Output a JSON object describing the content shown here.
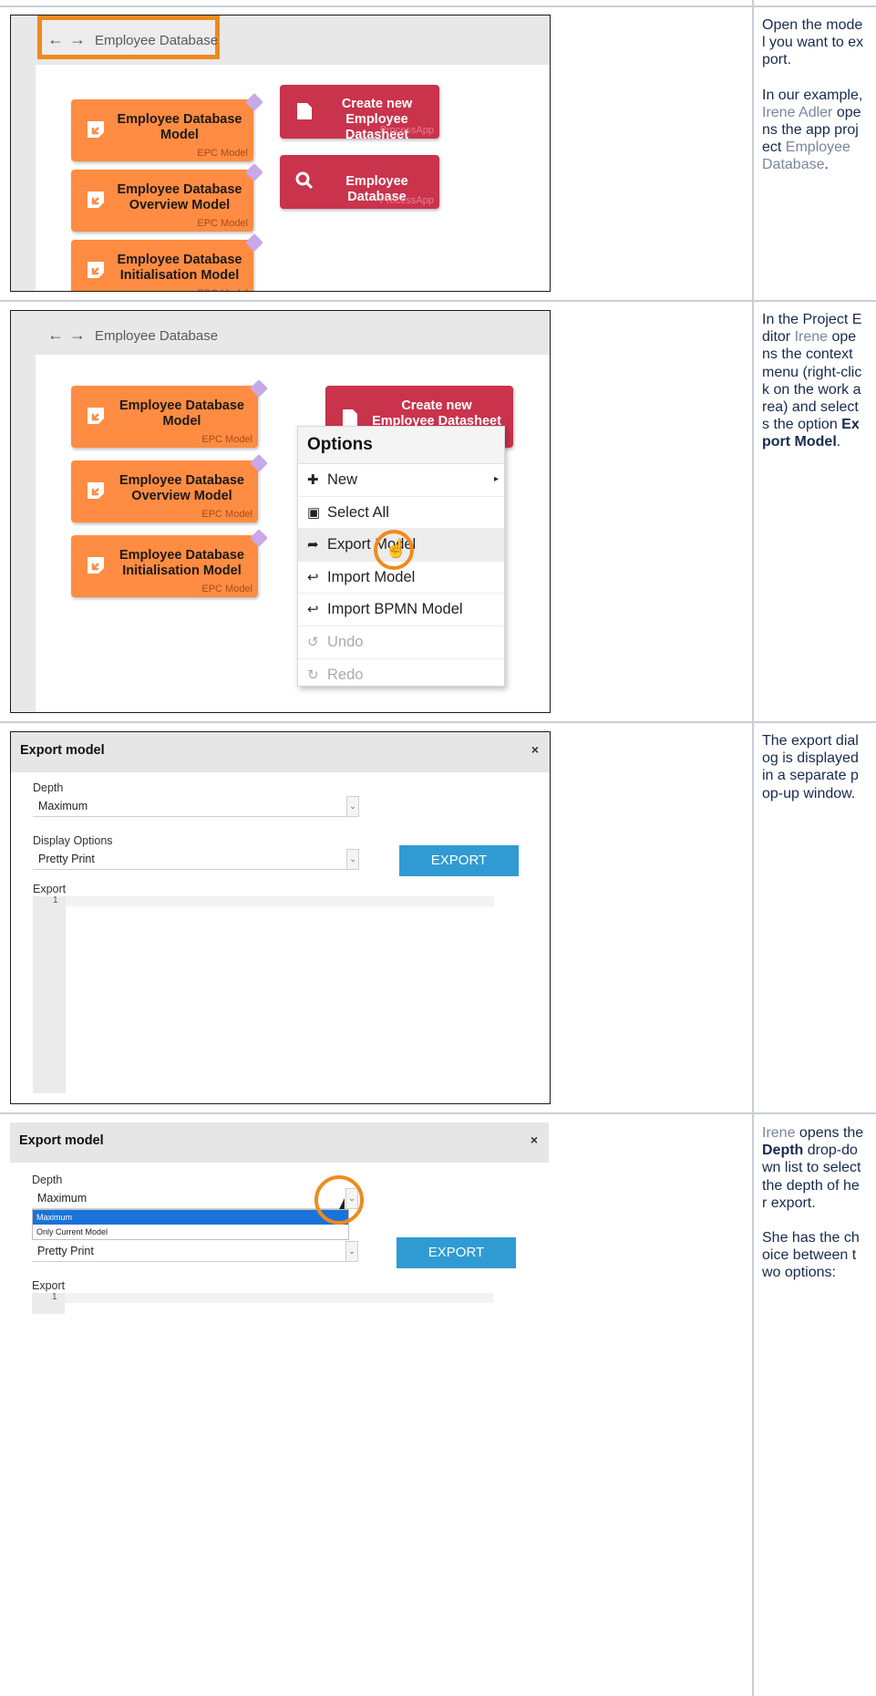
{
  "app": {
    "title": "Employee Database",
    "nav_back": "←",
    "nav_forward": "→"
  },
  "tiles": {
    "epc1": {
      "title": "Employee Database Model",
      "type": "EPC Model"
    },
    "epc2": {
      "title": "Employee Database Overview Model",
      "type": "EPC Model"
    },
    "epc3": {
      "title": "Employee Database Initialisation Model",
      "type": "EPC Model"
    },
    "app1": {
      "title": "Create new Employee Datasheet",
      "type": "ProcessApp"
    },
    "app2": {
      "title": "Employee Database",
      "type": "ProcessApp"
    }
  },
  "context_menu": {
    "header": "Options",
    "items": [
      {
        "label": "New",
        "icon": "plus-icon",
        "glyph": "✚",
        "submenu": "▸"
      },
      {
        "label": "Select All",
        "icon": "select-all-icon",
        "glyph": "▣"
      },
      {
        "label": "Export Model",
        "icon": "share-arrow-icon",
        "glyph": "➦"
      },
      {
        "label": "Import Model",
        "icon": "reply-arrow-icon",
        "glyph": "↩"
      },
      {
        "label": "Import BPMN Model",
        "icon": "reply-arrow-icon",
        "glyph": "↩"
      },
      {
        "label": "Undo",
        "icon": "undo-icon",
        "glyph": "↺"
      },
      {
        "label": "Redo",
        "icon": "redo-icon",
        "glyph": "↻"
      }
    ],
    "cursor": "☝"
  },
  "dialog": {
    "title": "Export model",
    "close": "×",
    "depth_label": "Depth",
    "depth_value": "Maximum",
    "display_label": "Display Options",
    "display_value": "Pretty Print",
    "export_label": "Export",
    "export_button": "EXPORT",
    "line_number": "1",
    "dropdown_arrow": "⌄",
    "depth_options": [
      "Maximum",
      "Only Current Model"
    ]
  },
  "steps": {
    "s1": {
      "p1": "Open the model you want to export.",
      "p2_pre": "In our example, ",
      "user": "Irene Adler",
      "p2_mid": " opens the app project ",
      "project": "Employee Database",
      "p2_end": "."
    },
    "s2": {
      "pre": "In the Project Editor ",
      "user": "Irene",
      "mid": " opens the context menu (right-click on the work area) and selects the option ",
      "option": "Export Model",
      "end": "."
    },
    "s3": {
      "text": "The export dialog is displayed in a separate pop-up window."
    },
    "s4": {
      "user": "Irene",
      "pre": " opens the ",
      "bold": "Depth",
      "post": " drop-down list to select the depth of her export.",
      "p2": "She has the choice between two options:"
    }
  }
}
